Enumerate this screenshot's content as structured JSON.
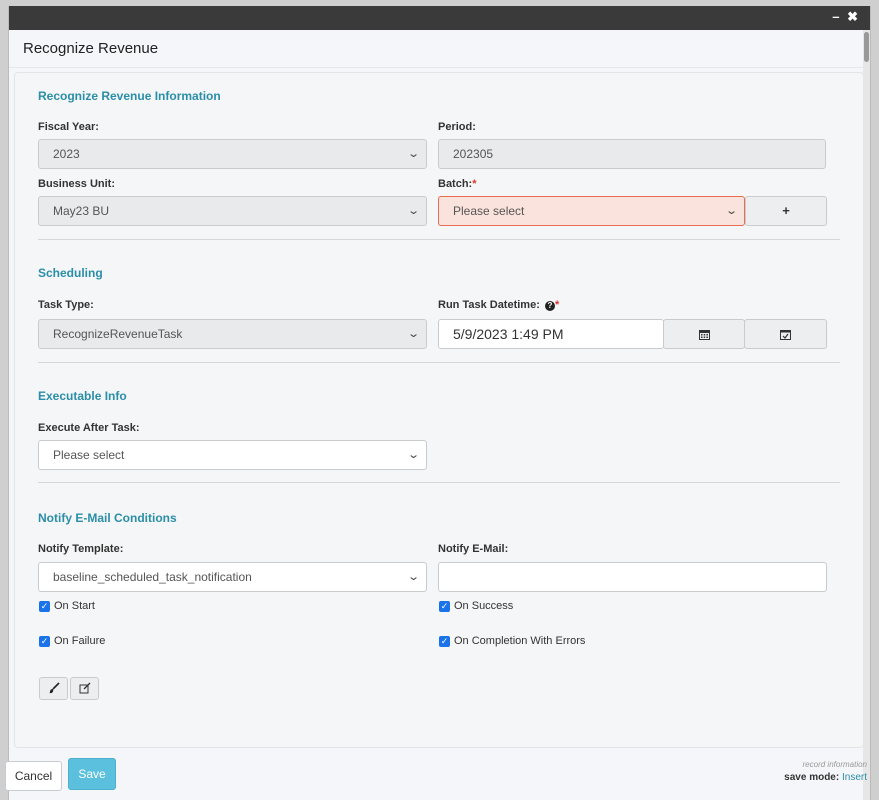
{
  "window": {
    "minimize_glyph": "–",
    "close_glyph": "✖",
    "title": "Recognize Revenue"
  },
  "sections": {
    "info_title": "Recognize Revenue Information",
    "scheduling_title": "Scheduling",
    "executable_title": "Executable Info",
    "notify_title": "Notify E-Mail Conditions"
  },
  "fields": {
    "fiscal_year_label": "Fiscal Year:",
    "fiscal_year_value": "2023",
    "period_label": "Period:",
    "period_value": "202305",
    "business_unit_label": "Business Unit:",
    "business_unit_value": "May23 BU",
    "batch_label": "Batch:",
    "batch_value": "Please select",
    "task_type_label": "Task Type:",
    "task_type_value": "RecognizeRevenueTask",
    "run_task_label": "Run Task Datetime:",
    "run_task_value": "5/9/2023 1:49 PM",
    "execute_after_label": "Execute After Task:",
    "execute_after_value": "Please select",
    "notify_template_label": "Notify Template:",
    "notify_template_value": "baseline_scheduled_task_notification",
    "notify_email_label": "Notify E-Mail:",
    "notify_email_value": ""
  },
  "required_marker": "*",
  "icons": {
    "add_batch": "plus-icon",
    "calendar": "calendar-icon",
    "calendar_check": "calendar-check-icon",
    "help": "question-circle-icon",
    "brush": "paintbrush-icon",
    "edit": "edit-icon",
    "chevron": "chevron-down-icon"
  },
  "checkboxes": {
    "on_start": "On Start",
    "on_success": "On Success",
    "on_failure": "On Failure",
    "on_completion_errors": "On Completion With Errors"
  },
  "footer": {
    "cancel_label": "Cancel",
    "save_label": "Save",
    "record_info": "record information",
    "save_mode_label": "save mode:",
    "save_mode_value": "Insert"
  },
  "colors": {
    "accent": "#2a8ea8",
    "save_button": "#5bc0de",
    "invalid_bg": "#fbe3dd",
    "checkbox": "#1a73e8"
  }
}
